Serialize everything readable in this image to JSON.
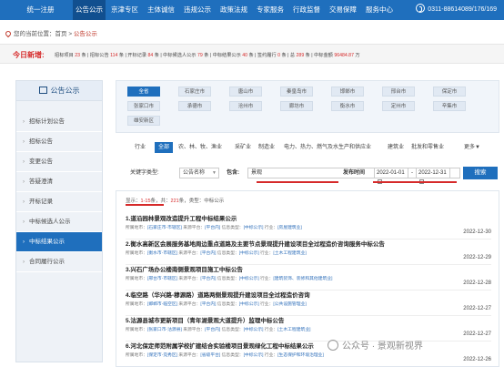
{
  "nav": {
    "items": [
      "统一注册",
      "公告公示",
      "京津专区",
      "主体诚信",
      "违规公示",
      "政策法规",
      "专家服务",
      "行政监督",
      "交易保障",
      "服务中心"
    ],
    "active_index": 1,
    "phone": "0311-88614089/176/169"
  },
  "breadcrumb": {
    "prefix": "您的当前位置：",
    "home": "首页",
    "sep": ">",
    "current": "公告公示"
  },
  "stats": {
    "lead": "今日新增:",
    "items": [
      {
        "label": "招标项目",
        "value": "23",
        "unit": "条"
      },
      {
        "label": "招标公告",
        "value": "114",
        "unit": "条"
      },
      {
        "label": "开标记录",
        "value": "84",
        "unit": "条"
      },
      {
        "label": "中标候选人公示",
        "value": "79",
        "unit": "条"
      },
      {
        "label": "中标结果公示",
        "value": "40",
        "unit": "条"
      },
      {
        "label": "签约履行",
        "value": "0",
        "unit": "条"
      },
      {
        "label": "总",
        "value": "289",
        "unit": "条"
      },
      {
        "label": "中标金额",
        "value": "96484.87",
        "unit": "万"
      }
    ]
  },
  "sidebar": {
    "title": "公告公示",
    "items": [
      "招标计划公告",
      "招标公告",
      "变更公告",
      "答疑澄清",
      "开标记录",
      "中标候选人公示",
      "中标结果公示",
      "合同履行公示"
    ],
    "active_index": 6
  },
  "regions": {
    "row1": [
      "全省",
      "石家庄市",
      "唐山市",
      "秦皇岛市",
      "邯郸市",
      "邢台市",
      "保定市"
    ],
    "row2": [
      "张家口市",
      "承德市",
      "沧州市",
      "廊坊市",
      "衡水市",
      "定州市",
      "辛集市"
    ],
    "row3": [
      "雄安新区"
    ],
    "active": "全省"
  },
  "industry": {
    "label": "行业",
    "all": "全部",
    "items": [
      "农、林、牧、渔业",
      "采矿业",
      "制造业",
      "电力、热力、燃气及水生产和供应业",
      "建筑业",
      "批发和零售业"
    ],
    "more": "更多▼"
  },
  "search": {
    "type_label": "关键字类型:",
    "type_value": "公告名称",
    "contains_label": "包含:",
    "keyword": "景观",
    "date_label": "发布时间",
    "date_from": "2022-01-01",
    "date_sep": "-",
    "date_to": "2022-12-31",
    "button": "搜索"
  },
  "results": {
    "summary_prefix": "显示：",
    "range": "1-15",
    "summary_mid": "条，共：",
    "total": "221",
    "summary_suffix": "条，类型：中标公示",
    "entries": [
      {
        "title": "1.道沿园林景观改造提升工程中标结果公示",
        "meta": [
          {
            "k": "所属地市：",
            "v": "[石家庄市-市辖区]"
          },
          {
            "k": "来源平台：",
            "v": "[平台内]"
          },
          {
            "k": "信息类型：",
            "v": "[中标公示]"
          },
          {
            "k": "行业：",
            "v": "[房屋建筑业]"
          }
        ],
        "date": "2022-12-30"
      },
      {
        "title": "2.衡水高新区会展服务基地周边重点道路及主要节点景观提升建设项目全过程造价咨询服务中标公告",
        "meta": [
          {
            "k": "所属地市：",
            "v": "[衡水市-市辖区]"
          },
          {
            "k": "来源平台：",
            "v": "[平台内]"
          },
          {
            "k": "信息类型：",
            "v": "[中标公示]"
          },
          {
            "k": "行业：",
            "v": "[土木工程建筑业]"
          }
        ],
        "date": "2022-12-29"
      },
      {
        "title": "3.兴石广场办公楼南侧景观项目施工中标公告",
        "meta": [
          {
            "k": "所属地市：",
            "v": "[邢台市-市辖区]"
          },
          {
            "k": "来源平台：",
            "v": "[平台内]"
          },
          {
            "k": "信息类型：",
            "v": "[中标公示]"
          },
          {
            "k": "行业：",
            "v": "[建筑装饰、装修和其他建筑业]"
          }
        ],
        "date": "2022-12-28"
      },
      {
        "title": "4.临空路（华兴路-穆源路）道路两侧景观提升建设项目全过程造价咨询",
        "meta": [
          {
            "k": "所属地市：",
            "v": "[邯郸市-临空区]"
          },
          {
            "k": "来源平台：",
            "v": "[平台内]"
          },
          {
            "k": "信息类型：",
            "v": "[中标公示]"
          },
          {
            "k": "行业：",
            "v": "[公共设施管理业]"
          }
        ],
        "date": "2022-12-27"
      },
      {
        "title": "5.沽源县城市更新项目（青年湖景观大道提升）监理中标公告",
        "meta": [
          {
            "k": "所属地市：",
            "v": "[张家口市-沽源县]"
          },
          {
            "k": "来源平台：",
            "v": "[平台内]"
          },
          {
            "k": "信息类型：",
            "v": "[中标公示]"
          },
          {
            "k": "行业：",
            "v": "[土木工程建筑业]"
          }
        ],
        "date": "2022-12-27"
      },
      {
        "title": "6.河北保定师范附属学校扩建结合实验楼项目景观绿化工程中标结果公示",
        "meta": [
          {
            "k": "所属地市：",
            "v": "[保定市-竞秀区]"
          },
          {
            "k": "来源平台：",
            "v": "[省级平台]"
          },
          {
            "k": "信息类型：",
            "v": "[中标公示]"
          },
          {
            "k": "行业：",
            "v": "[生态保护和环境治理业]"
          }
        ],
        "date": "2022-12-26"
      }
    ]
  },
  "watermark": "公众号 · 景观新视界"
}
